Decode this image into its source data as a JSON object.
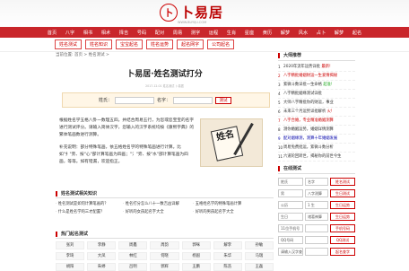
{
  "header": {
    "logo_char": "卜",
    "logo_text": "卜易居",
    "logo_url": "WWW.BUYIJU.COM"
  },
  "nav": [
    "首页",
    "八字",
    "相书",
    "相术",
    "择吉",
    "号码",
    "配对",
    "周易",
    "测字",
    "运程",
    "生肖",
    "星座",
    "黄历",
    "解梦",
    "风水",
    "占卜",
    "解梦",
    "起名"
  ],
  "subnav": [
    "姓名测试",
    "姓名知识",
    "宝宝起名",
    "姓名运势",
    "起名网字",
    "公司起名"
  ],
  "breadcrumb": "当前位置: 首页 > 姓名测试 >",
  "main": {
    "title": "卜易居·姓名测试打分",
    "date": "2017-12-01 姓名测试 卜易居",
    "form": {
      "surname_label": "姓氏：",
      "name_label": "名字：",
      "submit": "测试"
    },
    "intro_p1": "根据姓名学五格八卦一数理五四，并结合周易五行，为您或您宝宝的名字进行测试评分。请输入简体汉字，您输入的汉字系统均按《康熙字典》的繁体笔画数进行测算。",
    "intro_p2": "补充说明：部分特殊笔画，依五格姓名学的特殊笔画进行计算。比如\"扌\"旁、按\"心\"部计算笔画为四画；\"氵\"旁、按\"水\"部计算笔画为四画，等等。如有错漏，欢迎指正。",
    "image_text": "姓名"
  },
  "related": {
    "heading": "姓名测试相关知识",
    "items": [
      "姓名测试是如何计算笔画的？",
      "姓名打分怎么八十一数吉凶详解",
      "五格姓名学的特殊笔画计算",
      "什么是姓名学的三才配置？",
      "好听的女孩起名字大全",
      "好听的男孩起名字大全"
    ]
  },
  "tags": {
    "heading": "热门起名测试",
    "items": [
      "张刘",
      "李静",
      "周鑫",
      "周韵",
      "郭咪",
      "解李",
      "孙敏",
      "李琦",
      "大凤",
      "林红",
      "何晓",
      "杨国",
      "朱华",
      "马瑞",
      "胡阳",
      "朱婷",
      "吕明",
      "郭辉",
      "王鹏",
      "陈浩",
      "王磊"
    ]
  },
  "sidebar": {
    "rank_heading": "大师推荐",
    "rank_items": [
      {
        "num": "1",
        "text": "2020年流年运势详批",
        "badge": "最新!"
      },
      {
        "num": "2",
        "text": "八字精批婚姻财运一生爱情揭秘",
        "badge": ""
      },
      {
        "num": "3",
        "text": "紫微斗数详批一生命格",
        "badge": "超准!"
      },
      {
        "num": "4",
        "text": "八字精批姻缘测试详批",
        "badge": ""
      },
      {
        "num": "5",
        "text": "大师八字精批你的财运，事业",
        "badge": ""
      },
      {
        "num": "6",
        "text": "未来三个月运势详批解析",
        "badge": "火!"
      },
      {
        "num": "7",
        "text": "八字合婚，专业精准婚姻测算",
        "badge": ""
      },
      {
        "num": "8",
        "text": "测你婚姻运势，婚姻详情测算",
        "badge": ""
      },
      {
        "num": "9",
        "text": "配对姻缘测，测算十年婚姻发展",
        "badge": ""
      },
      {
        "num": "10",
        "text": "周易免费批运，紫微斗数分析",
        "badge": ""
      },
      {
        "num": "11",
        "text": "六道轮回转世，揭秘你的前世今生",
        "badge": ""
      }
    ],
    "tools_heading": "在线测试",
    "tools": [
      [
        "姓氏",
        "名字",
        "姓名测试"
      ],
      [
        "男",
        "八字测算",
        "生日测试"
      ],
      [
        "公历",
        "1 生",
        "生日运势"
      ],
      [
        "生日",
        "诸葛神算",
        "生日运势"
      ],
      [
        "11位手机号码",
        "",
        "手机号码"
      ],
      [
        "QQ号码",
        "",
        "QQ测试"
      ],
      [
        "请输入汉字查询",
        "",
        "起名查字"
      ]
    ]
  },
  "colors": {
    "brand_red": "#c9262b",
    "accent": "#cc0000"
  }
}
